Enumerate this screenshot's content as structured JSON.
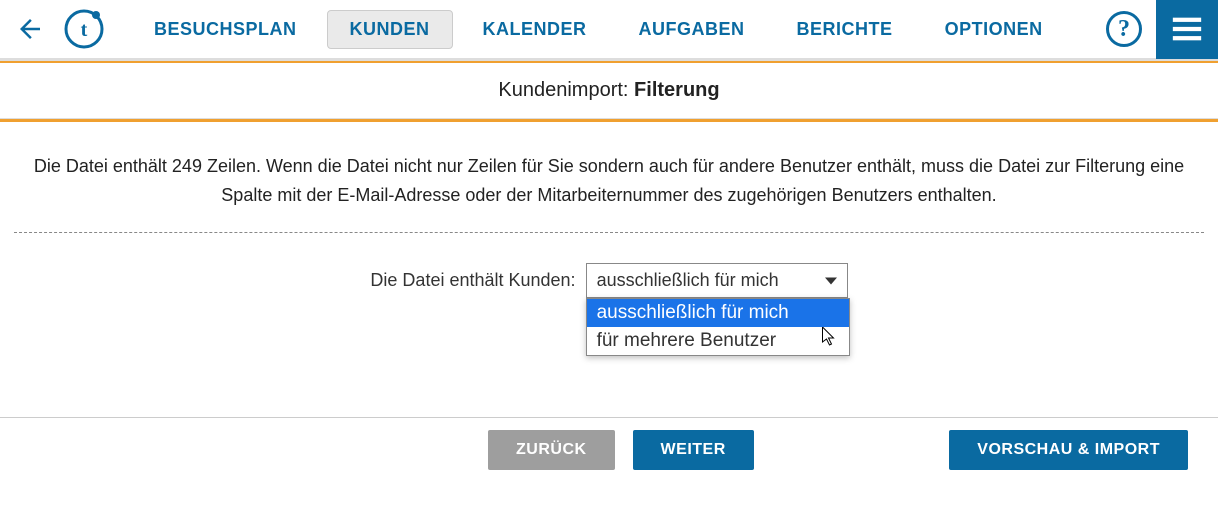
{
  "nav": {
    "items": [
      {
        "label": "BESUCHSPLAN",
        "active": false
      },
      {
        "label": "KUNDEN",
        "active": true
      },
      {
        "label": "KALENDER",
        "active": false
      },
      {
        "label": "AUFGABEN",
        "active": false
      },
      {
        "label": "BERICHTE",
        "active": false
      },
      {
        "label": "OPTIONEN",
        "active": false
      }
    ],
    "help_label": "?"
  },
  "page_title": {
    "prefix": "Kundenimport: ",
    "main": "Filterung"
  },
  "content": {
    "info_text": "Die Datei enthält 249 Zeilen. Wenn die Datei nicht nur Zeilen für Sie sondern auch für andere Benutzer enthält, muss die Datei zur Filterung eine Spalte mit der E-Mail-Adresse oder der Mitarbeiternummer des zugehörigen Benutzers enthalten.",
    "form": {
      "label": "Die Datei enthält Kunden:",
      "selected": "ausschließlich für mich",
      "options": [
        "ausschließlich für mich",
        "für mehrere Benutzer"
      ]
    }
  },
  "footer": {
    "back": "ZURÜCK",
    "next": "WEITER",
    "preview": "VORSCHAU & IMPORT"
  }
}
